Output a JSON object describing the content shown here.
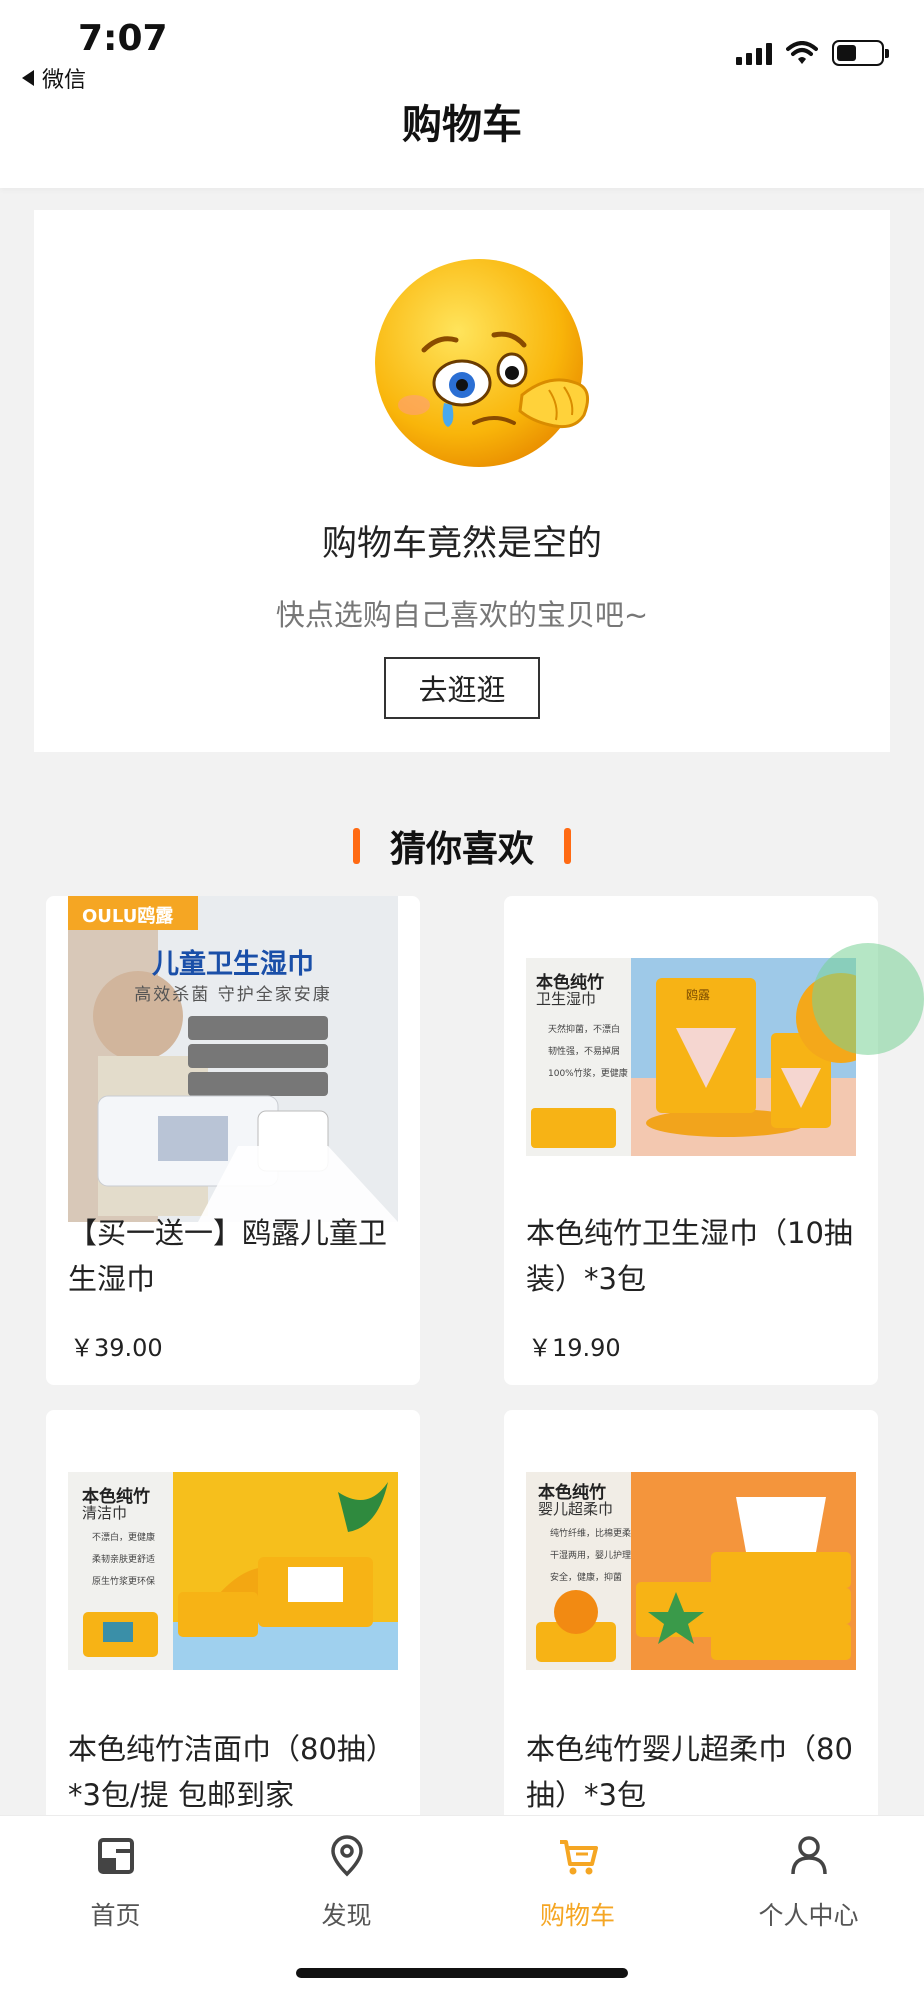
{
  "status_bar": {
    "time": "7:07",
    "back_app": "微信"
  },
  "nav": {
    "title": "购物车"
  },
  "empty_state": {
    "title": "购物车竟然是空的",
    "subtitle": "快点选购自己喜欢的宝贝吧~",
    "button_label": "去逛逛"
  },
  "recommend": {
    "section_title": "猜你喜欢",
    "products": [
      {
        "name": "【买一送一】鸥露儿童卫生湿巾",
        "price": "￥39.00",
        "image": {
          "brand_badge": "OULU鸥露",
          "headline": "儿童卫生湿巾",
          "tagline": "高效杀菌 守护全家安康"
        }
      },
      {
        "name": "本色纯竹卫生湿巾（10抽装）*3包",
        "price": "￥19.90",
        "image": {
          "headline": "本色纯竹",
          "subhead": "卫生湿巾",
          "features": [
            "天然抑菌，不漂白",
            "韧性强，不易掉屑",
            "100%竹浆，更健康"
          ],
          "pack_label": "鸥露"
        }
      },
      {
        "name": "本色纯竹洁面巾（80抽）*3包/提 包邮到家",
        "price": "",
        "image": {
          "headline": "本色纯竹",
          "subhead": "清洁巾",
          "features": [
            "不漂白，更健康",
            "柔韧亲肤更舒适",
            "原生竹浆更环保"
          ]
        }
      },
      {
        "name": "本色纯竹婴儿超柔巾（80抽）*3包",
        "price": "",
        "image": {
          "headline": "本色纯竹",
          "subhead": "婴儿超柔巾",
          "features": [
            "纯竹纤维，比棉更柔",
            "干湿两用，婴儿护理",
            "安全，健康，抑菌"
          ]
        }
      }
    ]
  },
  "tabbar": {
    "tabs": [
      {
        "label": "首页",
        "icon": "home-icon",
        "active": false
      },
      {
        "label": "发现",
        "icon": "location-pin-icon",
        "active": false
      },
      {
        "label": "购物车",
        "icon": "cart-icon",
        "active": true
      },
      {
        "label": "个人中心",
        "icon": "person-icon",
        "active": false
      }
    ],
    "active_color": "#f5a623"
  },
  "colors": {
    "accent": "#ff6a13",
    "tab_active": "#f5a623",
    "brand_yellow": "#ffb400"
  }
}
